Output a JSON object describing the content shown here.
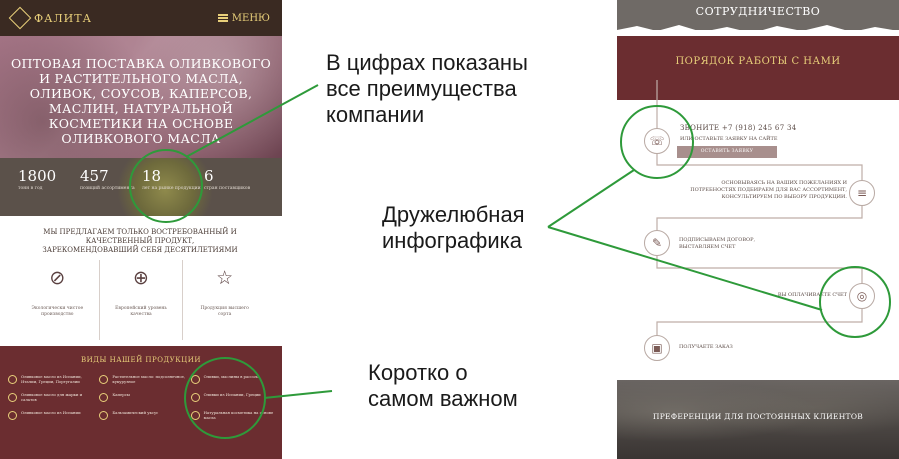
{
  "left_screen": {
    "logo_text": "ФАЛИТА",
    "menu_label": "МЕНЮ",
    "hero_title": "ОПТОВАЯ ПОСТАВКА ОЛИВКОВОГО И РАСТИТЕЛЬНОГО МАСЛА, ОЛИВОК, СОУСОВ, КАПЕРСОВ, МАСЛИН, НАТУРАЛЬНОЙ КОСМЕТИКИ НА ОСНОВЕ ОЛИВКОВОГО МАСЛА",
    "stats": [
      {
        "value": "1800",
        "caption": "тонн в год"
      },
      {
        "value": "457",
        "caption": "позиций ассортимента"
      },
      {
        "value": "18",
        "caption": "лет на рынке продукции"
      },
      {
        "value": "6",
        "caption": "стран поставщиков"
      }
    ],
    "offer_text": "МЫ ПРЕДЛАГАЕМ ТОЛЬКО ВОСТРЕБОВАННЫЙ И КАЧЕСТВЕННЫЙ ПРОДУКТ, ЗАРЕКОМЕНДОВАВШИЙ СЕБЯ ДЕСЯТИЛЕТИЯМИ",
    "features": [
      {
        "icon": "olive-icon",
        "glyph": "⊘",
        "text": "Экологически чистое производство"
      },
      {
        "icon": "globe-icon",
        "glyph": "⊕",
        "text": "Европейский уровень качества"
      },
      {
        "icon": "star-icon",
        "glyph": "☆",
        "text": "Продукция высшего сорта"
      }
    ],
    "products_title": "ВИДЫ НАШЕЙ ПРОДУКЦИИ",
    "products": [
      "Оливковое масло из Испании, Италии, Греции, Португалии",
      "Растительное масло: подсолнечное, кукурузное",
      "Оливки, маслины в рассоле",
      "Оливковое масло для жарки и салатов",
      "Каперсы",
      "Оливки из Испании, Греции",
      "Оливковое масло из Испании",
      "Бальзамический уксус",
      "Натуральная косметика на основе масла"
    ]
  },
  "right_screen": {
    "top_title": "СОТРУДНИЧЕСТВО",
    "band_title": "ПОРЯДОК РАБОТЫ С НАМИ",
    "phone_text": "ЗВОНИТЕ +7 (918) 245 67 34",
    "phone_sub": "ИЛИ ОСТАВЬТЕ ЗАЯВКУ НА САЙТЕ",
    "order_button": "ОСТАВИТЬ ЗАЯВКУ",
    "steps": [
      {
        "icon": "document-icon",
        "glyph": "≡",
        "text": "ОСНОВЫВАЯСЬ НА ВАШИХ ПОЖЕЛАНИЯХ И ПОТРЕБНОСТЯХ ПОДБИРАЕМ ДЛЯ ВАС АССОРТИМЕНТ, КОНСУЛЬТИРУЕМ ПО ВЫБОРУ ПРОДУКЦИИ."
      },
      {
        "icon": "contract-icon",
        "glyph": "✎",
        "text": "ПОДПИСЫВАЕМ ДОГОВОР, ВЫСТАВЛЯЕМ СЧЕТ"
      },
      {
        "icon": "coins-icon",
        "glyph": "◎",
        "text": "ВЫ ОПЛАЧИВАЕТЕ СЧЕТ"
      },
      {
        "icon": "box-icon",
        "glyph": "▣",
        "text": "ПОЛУЧАЕТЕ ЗАКАЗ"
      }
    ],
    "bottom_title": "ПРЕФЕРЕНЦИИ ДЛЯ ПОСТОЯННЫХ КЛИЕНТОВ"
  },
  "callouts": {
    "numbers": "В цифрах показаны\nвсе преимущества\nкомпании",
    "infographic": "Дружелюбная\nинфографика",
    "brief": "Коротко о\nсамом важном"
  },
  "colors": {
    "accent_green": "#2e9a3a",
    "burgundy": "#6b2d30",
    "gold": "#e8cf7a"
  }
}
